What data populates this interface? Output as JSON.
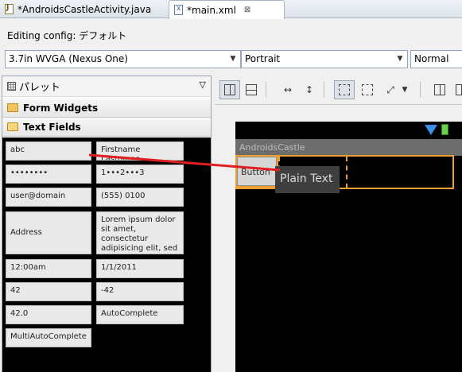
{
  "tabs": [
    {
      "label": "*AndroidsCastleActivity.java",
      "icon": "java-file-icon"
    },
    {
      "label": "*main.xml",
      "icon": "xml-file-icon",
      "active": true,
      "close": "⊠"
    }
  ],
  "config": {
    "label": "Editing config: デフォルト",
    "device": "3.7in WVGA (Nexus One)",
    "orientation": "Portrait",
    "mode": "Normal"
  },
  "palette": {
    "title": "パレット",
    "sections": [
      {
        "label": "Form Widgets",
        "expanded": false
      },
      {
        "label": "Text Fields",
        "expanded": true
      }
    ],
    "widgets": [
      "abc",
      "Firstname Lastname",
      "••••••••",
      "1•••2•••3",
      "user@domain",
      "(555) 0100",
      "Address",
      "Lorem ipsum dolor sit amet, consectetur adipisicing elit, sed do eiusmod tempor",
      "12:00am",
      "1/1/2011",
      "42",
      "-42",
      "42.0",
      "AutoComplete",
      "MultiAutoComplete"
    ]
  },
  "preview": {
    "app_title": "AndroidsCastle",
    "button_label": "Button",
    "dragged_widget": "Plain Text"
  },
  "colors": {
    "selection": "#f0a030",
    "drag_line": "#e02020",
    "device_bg": "#000000"
  }
}
